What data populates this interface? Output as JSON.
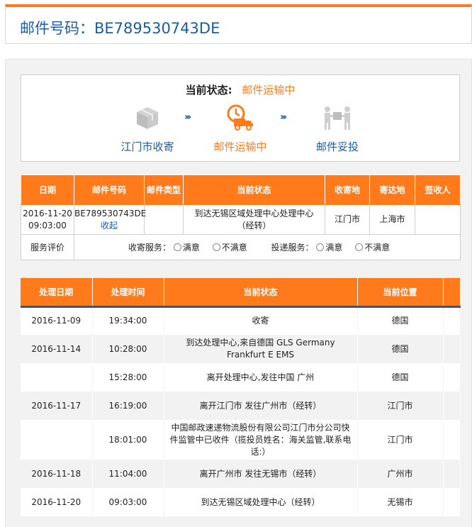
{
  "header": {
    "title": "邮件号码：BE789530743DE"
  },
  "status": {
    "label": "当前状态:",
    "value": "邮件运输中",
    "steps": [
      {
        "label": "江门市收寄",
        "icon": "parcel-box-icon",
        "state": "done"
      },
      {
        "label": "邮件运输中",
        "icon": "delivery-truck-icon",
        "state": "active"
      },
      {
        "label": "邮件妥投",
        "icon": "delivered-handover-icon",
        "state": "pending"
      }
    ],
    "arrow": "›››"
  },
  "mail_table": {
    "headers": [
      "日期",
      "邮件号码",
      "邮件类型",
      "当前状态",
      "收寄地",
      "寄达地",
      "签收人"
    ],
    "row": {
      "date": "2016-11-20 09:03:00",
      "number": "BE789530743DE",
      "number_link": "收起",
      "type": "",
      "status": "到达无锡区域处理中心处理中心（经转）",
      "origin": "江门市",
      "destination": "上海市",
      "signer": ""
    },
    "service": {
      "label": "服务评价",
      "collect_label": "收寄服务：",
      "deliver_label": "投递服务：",
      "satisfied": "满意",
      "unsatisfied": "不满意"
    }
  },
  "track_table": {
    "headers": [
      "处理日期",
      "处理时间",
      "当前状态",
      "当前位置"
    ],
    "rows": [
      {
        "date": "2016-11-09",
        "time": "19:34:00",
        "status": "收寄",
        "location": "德国"
      },
      {
        "date": "2016-11-14",
        "time": "10:28:00",
        "status": "到达处理中心,来自德国  GLS Germany Frankfurt E EMS",
        "location": "德国"
      },
      {
        "date": "",
        "time": "15:28:00",
        "status": "离开处理中心,发往中国 广州",
        "location": "德国"
      },
      {
        "date": "2016-11-17",
        "time": "16:19:00",
        "status": "离开江门市 发往广州市（经转）",
        "location": "江门市"
      },
      {
        "date": "",
        "time": "18:01:00",
        "status": "中国邮政速递物流股份有限公司江门市分公司快件监管中已收件（揽投员姓名：海关监管,联系电话:）",
        "location": "江门市"
      },
      {
        "date": "2016-11-18",
        "time": "11:04:00",
        "status": "离开广州市 发往无锡市（经转）",
        "location": "广州市"
      },
      {
        "date": "2016-11-20",
        "time": "09:03:00",
        "status": "到达无锡区域处理中心（经转）",
        "location": "无锡市"
      }
    ]
  }
}
